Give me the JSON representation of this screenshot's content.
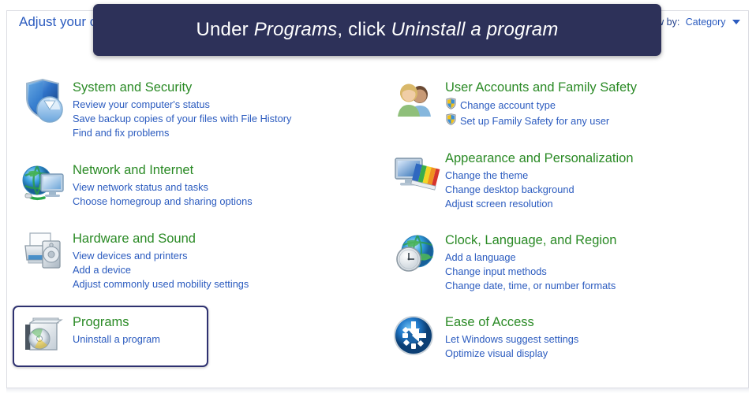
{
  "window": {
    "headline": "Adjust your computer's settings",
    "view_by_label": "View by:",
    "view_by_value": "Category",
    "view_by_caret_icon": "chevron-down-icon"
  },
  "caption": {
    "prefix": "Under ",
    "emphasis_1": "Programs",
    "middle": ", click ",
    "emphasis_2": "Uninstall a program",
    "background_color": "#2d3159",
    "text_color": "#ffffff"
  },
  "theme": {
    "heading_green": "#2a8a25",
    "link_blue": "#2b5bbf",
    "highlight_border": "#2e3170",
    "card_border": "#dcdde3",
    "page_background": "#ffffff"
  },
  "categories": {
    "left": [
      {
        "title": "System and Security",
        "icon": "shield-pie-icon",
        "highlighted": false,
        "links": [
          {
            "label": "Review your computer's status",
            "shield": false
          },
          {
            "label": "Save backup copies of your files with File History",
            "shield": false
          },
          {
            "label": "Find and fix problems",
            "shield": false
          }
        ]
      },
      {
        "title": "Network and Internet",
        "icon": "globe-monitor-icon",
        "highlighted": false,
        "links": [
          {
            "label": "View network status and tasks",
            "shield": false
          },
          {
            "label": "Choose homegroup and sharing options",
            "shield": false
          }
        ]
      },
      {
        "title": "Hardware and Sound",
        "icon": "printer-speaker-icon",
        "highlighted": false,
        "links": [
          {
            "label": "View devices and printers",
            "shield": false
          },
          {
            "label": "Add a device",
            "shield": false
          },
          {
            "label": "Adjust commonly used mobility settings",
            "shield": false
          }
        ]
      },
      {
        "title": "Programs",
        "icon": "programs-disc-icon",
        "highlighted": true,
        "links": [
          {
            "label": "Uninstall a program",
            "shield": false
          }
        ]
      }
    ],
    "right": [
      {
        "title": "User Accounts and Family Safety",
        "icon": "users-icon",
        "highlighted": false,
        "links": [
          {
            "label": "Change account type",
            "shield": true
          },
          {
            "label": "Set up Family Safety for any user",
            "shield": true
          }
        ]
      },
      {
        "title": "Appearance and Personalization",
        "icon": "monitor-palette-icon",
        "highlighted": false,
        "links": [
          {
            "label": "Change the theme",
            "shield": false
          },
          {
            "label": "Change desktop background",
            "shield": false
          },
          {
            "label": "Adjust screen resolution",
            "shield": false
          }
        ]
      },
      {
        "title": "Clock, Language, and Region",
        "icon": "globe-clock-icon",
        "highlighted": false,
        "links": [
          {
            "label": "Add a language",
            "shield": false
          },
          {
            "label": "Change input methods",
            "shield": false
          },
          {
            "label": "Change date, time, or number formats",
            "shield": false
          }
        ]
      },
      {
        "title": "Ease of Access",
        "icon": "ease-of-access-icon",
        "highlighted": false,
        "links": [
          {
            "label": "Let Windows suggest settings",
            "shield": false
          },
          {
            "label": "Optimize visual display",
            "shield": false
          }
        ]
      }
    ]
  }
}
